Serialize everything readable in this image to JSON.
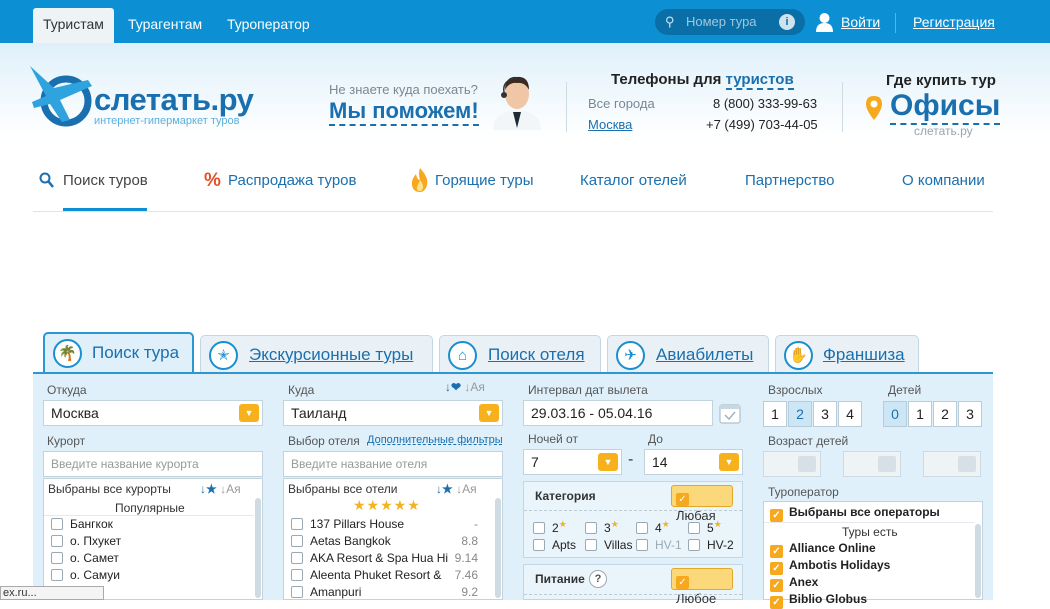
{
  "topnav": {
    "tabs": [
      "Туристам",
      "Турагентам",
      "Туроператор"
    ],
    "search_placeholder": "Номер тура",
    "info": "i",
    "login": "Войти",
    "register": "Регистрация"
  },
  "header": {
    "logo": "слетать.ру",
    "logo_sub": "интернет-гипермаркет туров",
    "ask": "Не знаете куда поехать?",
    "help": "Мы поможем!",
    "phones_title_prefix": "Телефоны для",
    "phones_title_link": "туристов",
    "cities": [
      "Все города",
      "Москва"
    ],
    "numbers": [
      "8 (800) 333-99-63",
      "+7 (499) 703-44-05"
    ],
    "where_buy": "Где купить тур",
    "offices": "Офисы",
    "site": "слетать.ру"
  },
  "mainnav": [
    "Поиск туров",
    "Распродажа туров",
    "Горящие туры",
    "Каталог отелей",
    "Партнерство",
    "О компании"
  ],
  "formtabs": [
    "Поиск тура",
    "Экскурсионные туры",
    "Поиск отеля",
    "Авиабилеты",
    "Франшиза"
  ],
  "form": {
    "from_label": "Откуда",
    "from_value": "Москва",
    "to_label": "Куда",
    "to_sort": "Ая",
    "to_value": "Таиланд",
    "resort_label": "Курорт",
    "resort_placeholder": "Введите название курорта",
    "resorts_all": "Выбраны все курорты",
    "sort_alpha": "Ая",
    "popular": "Популярные",
    "resorts": [
      "Бангкок",
      "о. Пхукет",
      "о. Самет",
      "о. Самуи"
    ],
    "hotel_label": "Выбор отеля",
    "filters_link": "Дополнительные фильтры",
    "hotel_placeholder": "Введите название отеля",
    "hotels_all": "Выбраны все отели",
    "hotels": [
      {
        "name": "137 Pillars House",
        "rating": "-"
      },
      {
        "name": "Aetas Bangkok",
        "rating": "8.8"
      },
      {
        "name": "AKA Resort & Spa Hua Hi",
        "rating": "9.14"
      },
      {
        "name": "Aleenta Phuket Resort &",
        "rating": "7.46"
      },
      {
        "name": "Amanpuri",
        "rating": "9.2"
      }
    ],
    "dates_label": "Интервал дат вылета",
    "dates_value": "29.03.16 - 05.04.16",
    "nights_from_label": "Ночей от",
    "nights_to_label": "До",
    "nights_from": "7",
    "nights_to": "14",
    "dash": "-",
    "category_label": "Категория",
    "any_cat": "Любая",
    "cats": [
      "2",
      "3",
      "4",
      "5",
      "Apts",
      "Villas",
      "HV-1",
      "HV-2"
    ],
    "meal_label": "Питание",
    "any_meal": "Любое",
    "adults_label": "Взрослых",
    "adults": [
      "1",
      "2",
      "3",
      "4"
    ],
    "children_label": "Детей",
    "children": [
      "0",
      "1",
      "2",
      "3"
    ],
    "child_age_label": "Возраст детей",
    "operator_label": "Туроператор",
    "operators_all": "Выбраны все операторы",
    "tours_exist": "Туры есть",
    "operators": [
      "Alliance Online",
      "Ambotis Holidays",
      "Anex",
      "Biblio Globus"
    ]
  },
  "tooltip": "ex.ru..."
}
